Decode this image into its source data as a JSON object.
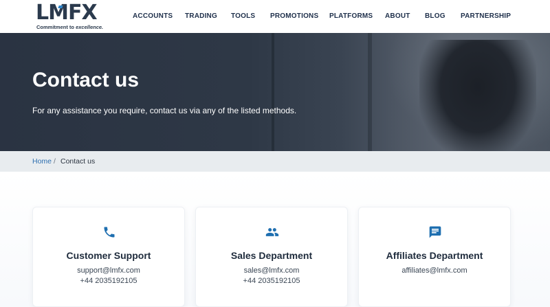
{
  "brand": {
    "logo_text_part1": "LM",
    "logo_text_part2": "FX",
    "tagline_prefix": "Commitment to",
    "tagline_emphasis": "excellence."
  },
  "nav": {
    "items": [
      {
        "label": "ACCOUNTS"
      },
      {
        "label": "TRADING"
      },
      {
        "label": "TOOLS"
      },
      {
        "label": "PROMOTIONS"
      },
      {
        "label": "PLATFORMS"
      },
      {
        "label": "ABOUT"
      },
      {
        "label": "BLOG"
      },
      {
        "label": "PARTNERSHIP"
      }
    ]
  },
  "hero": {
    "title": "Contact us",
    "subtitle": "For any assistance you require, contact us via any of the listed methods."
  },
  "breadcrumb": {
    "home": "Home",
    "separator": "/",
    "current": "Contact us"
  },
  "cards": [
    {
      "icon": "phone-icon",
      "title": "Customer Support",
      "line1": "support@lmfx.com",
      "line2": "+44 2035192105"
    },
    {
      "icon": "people-icon",
      "title": "Sales Department",
      "line1": "sales@lmfx.com",
      "line2": "+44 2035192105"
    },
    {
      "icon": "chat-icon",
      "title": "Affiliates Department",
      "line1": "affiliates@lmfx.com",
      "line2": ""
    }
  ],
  "colors": {
    "accent": "#1f6fb0",
    "nav_text": "#1e2f4a",
    "hero_bg": "#2e3846",
    "breadcrumb_bg": "#e8ecef"
  }
}
